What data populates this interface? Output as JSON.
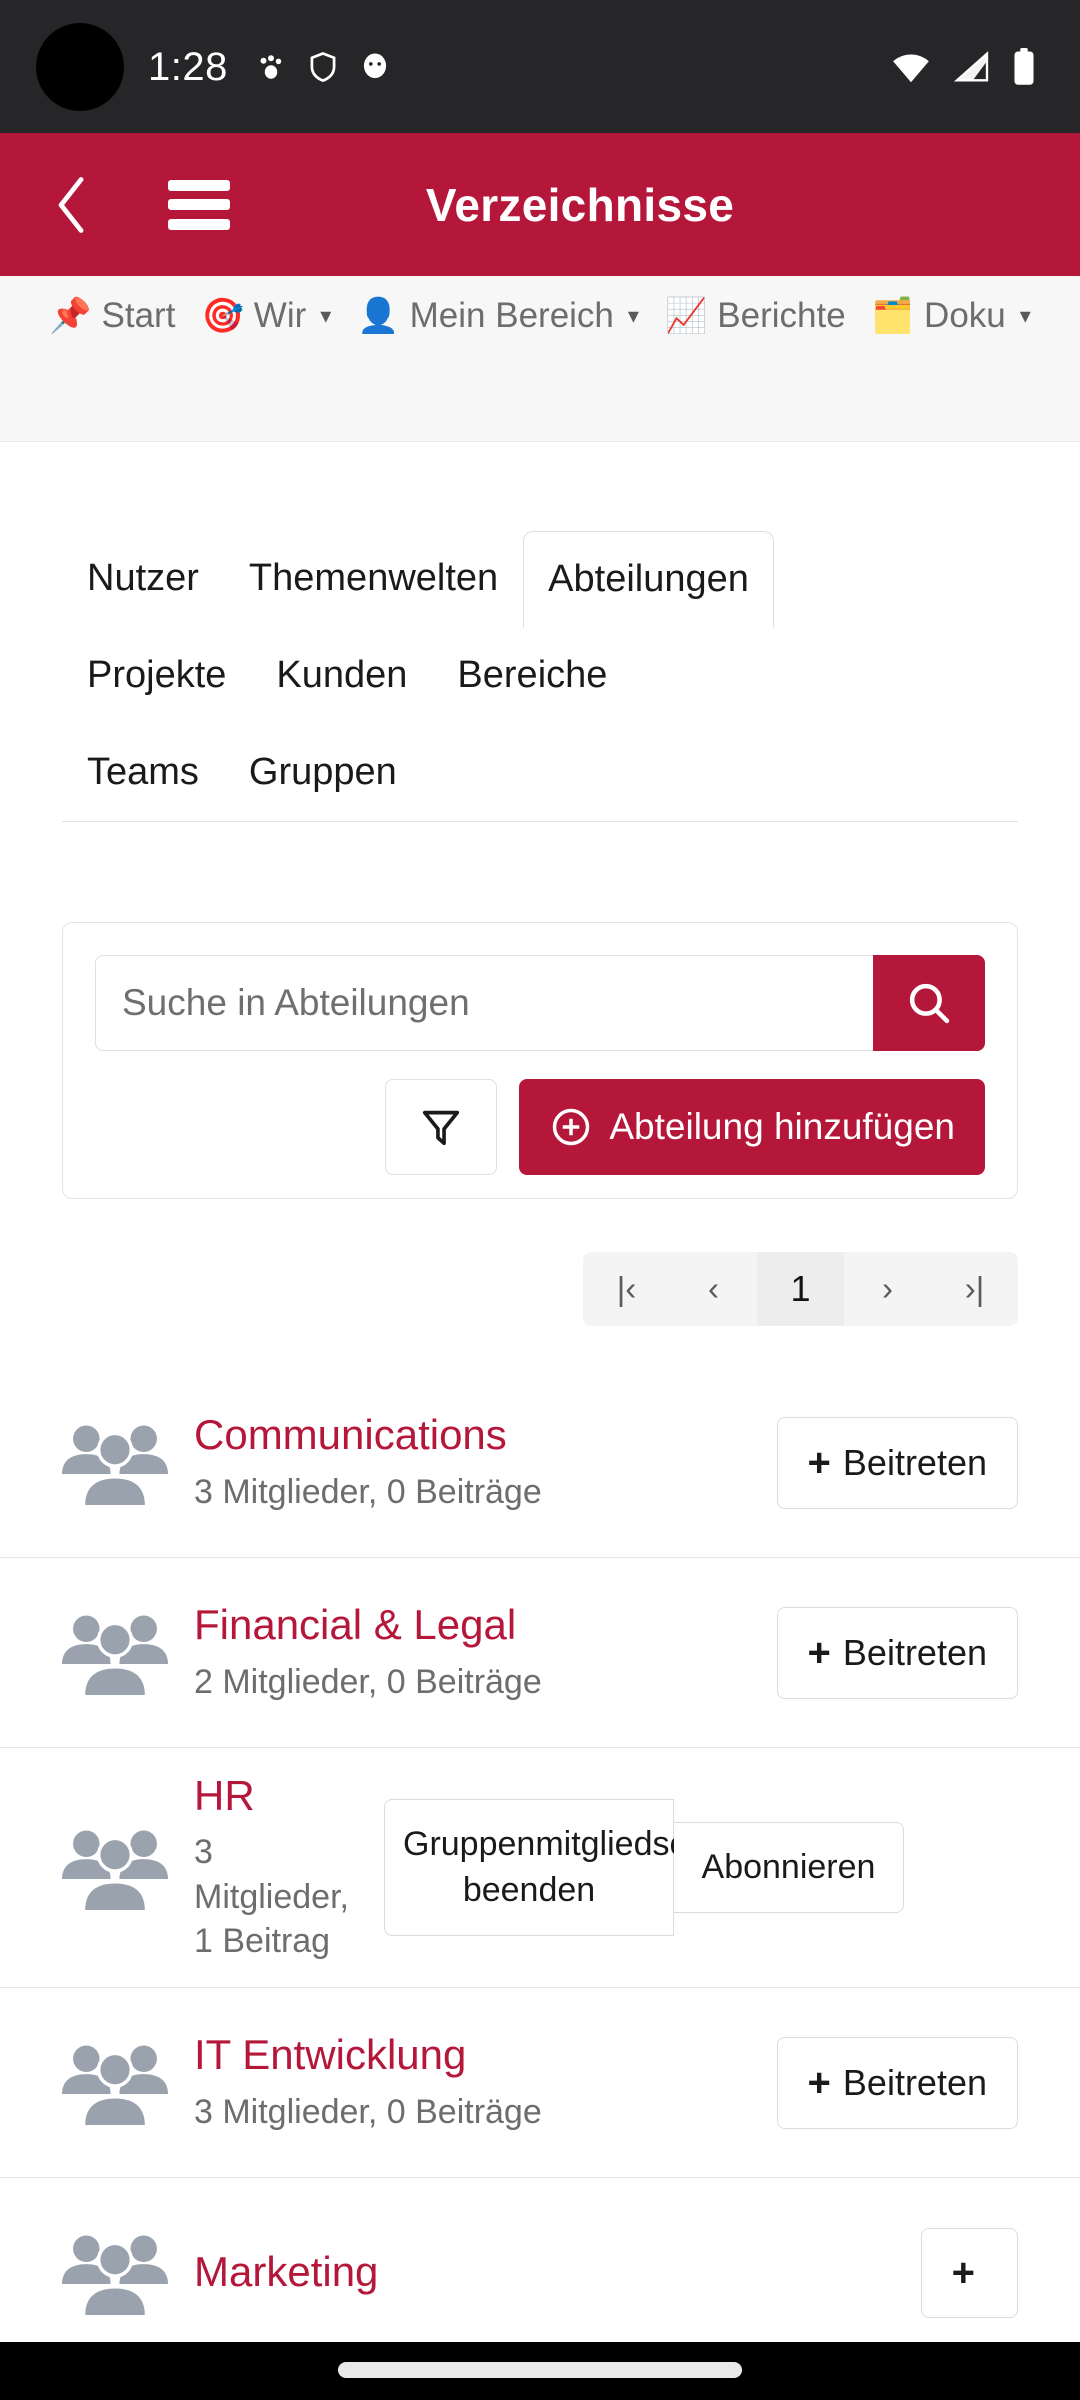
{
  "status_bar": {
    "time": "1:28",
    "left_icons": [
      "pet-icon",
      "shield-icon",
      "ghost-icon"
    ],
    "right_icons": [
      "wifi-icon",
      "cellular-signal-icon",
      "battery-icon"
    ]
  },
  "app_bar": {
    "back_label": "‹",
    "menu_label": "menu",
    "title": "Verzeichnisse",
    "color": "#B5173A"
  },
  "nav_strip": {
    "items": [
      {
        "emoji": "📌",
        "label": "Start",
        "caret": ""
      },
      {
        "emoji": "🎯",
        "label": "Wir",
        "caret": "▾"
      },
      {
        "emoji": "👤",
        "label": "Mein Bereich",
        "caret": "▾"
      },
      {
        "emoji": "📈",
        "label": "Berichte",
        "caret": ""
      },
      {
        "emoji": "🗂️",
        "label": "Doku",
        "caret": "▾"
      }
    ]
  },
  "tabs": {
    "items": [
      {
        "label": "Nutzer",
        "active": false
      },
      {
        "label": "Themenwelten",
        "active": false
      },
      {
        "label": "Abteilungen",
        "active": true
      },
      {
        "label": "Projekte",
        "active": false
      },
      {
        "label": "Kunden",
        "active": false
      },
      {
        "label": "Bereiche",
        "active": false
      },
      {
        "label": "Teams",
        "active": false
      },
      {
        "label": "Gruppen",
        "active": false
      }
    ]
  },
  "search": {
    "placeholder": "Suche in Abteilungen",
    "value": "",
    "search_icon": "search-icon",
    "filter_icon": "filter-funnel-icon",
    "add_label": "Abteilung hinzufügen",
    "add_icon": "⊕"
  },
  "pagination": {
    "first": "|‹",
    "prev": "‹",
    "current": "1",
    "next": "›",
    "last": "›|"
  },
  "list": {
    "rows": [
      {
        "title": "Communications",
        "subtitle": "3 Mitglieder, 0 Beiträge",
        "action": "+ Beitreten",
        "action_label": "Beitreten",
        "type": "join"
      },
      {
        "title": "Financial & Legal",
        "subtitle": "2 Mitglieder, 0 Beiträge",
        "action": "+ Beitreten",
        "action_label": "Beitreten",
        "type": "join"
      },
      {
        "title": "HR",
        "subtitle": "3 Mitglieder, 1 Beitrag",
        "action_label": "Gruppenmitgliedschaft beenden",
        "action_label_2": "Abonnieren",
        "type": "member"
      },
      {
        "title": "IT Entwicklung",
        "subtitle": "3 Mitglieder, 0 Beiträge",
        "action": "+ Beitreten",
        "action_label": "Beitreten",
        "type": "join"
      },
      {
        "title": "Marketing",
        "subtitle": "",
        "action_label": "",
        "type": "join"
      }
    ],
    "group_icon": "people-group-icon"
  },
  "colors": {
    "brand_red": "#B5173A",
    "status_bar": "#262628",
    "nav_strip_bg": "#F7F7F7",
    "muted_text": "#6d6d6d",
    "icon_gray": "#9aa2ae"
  }
}
